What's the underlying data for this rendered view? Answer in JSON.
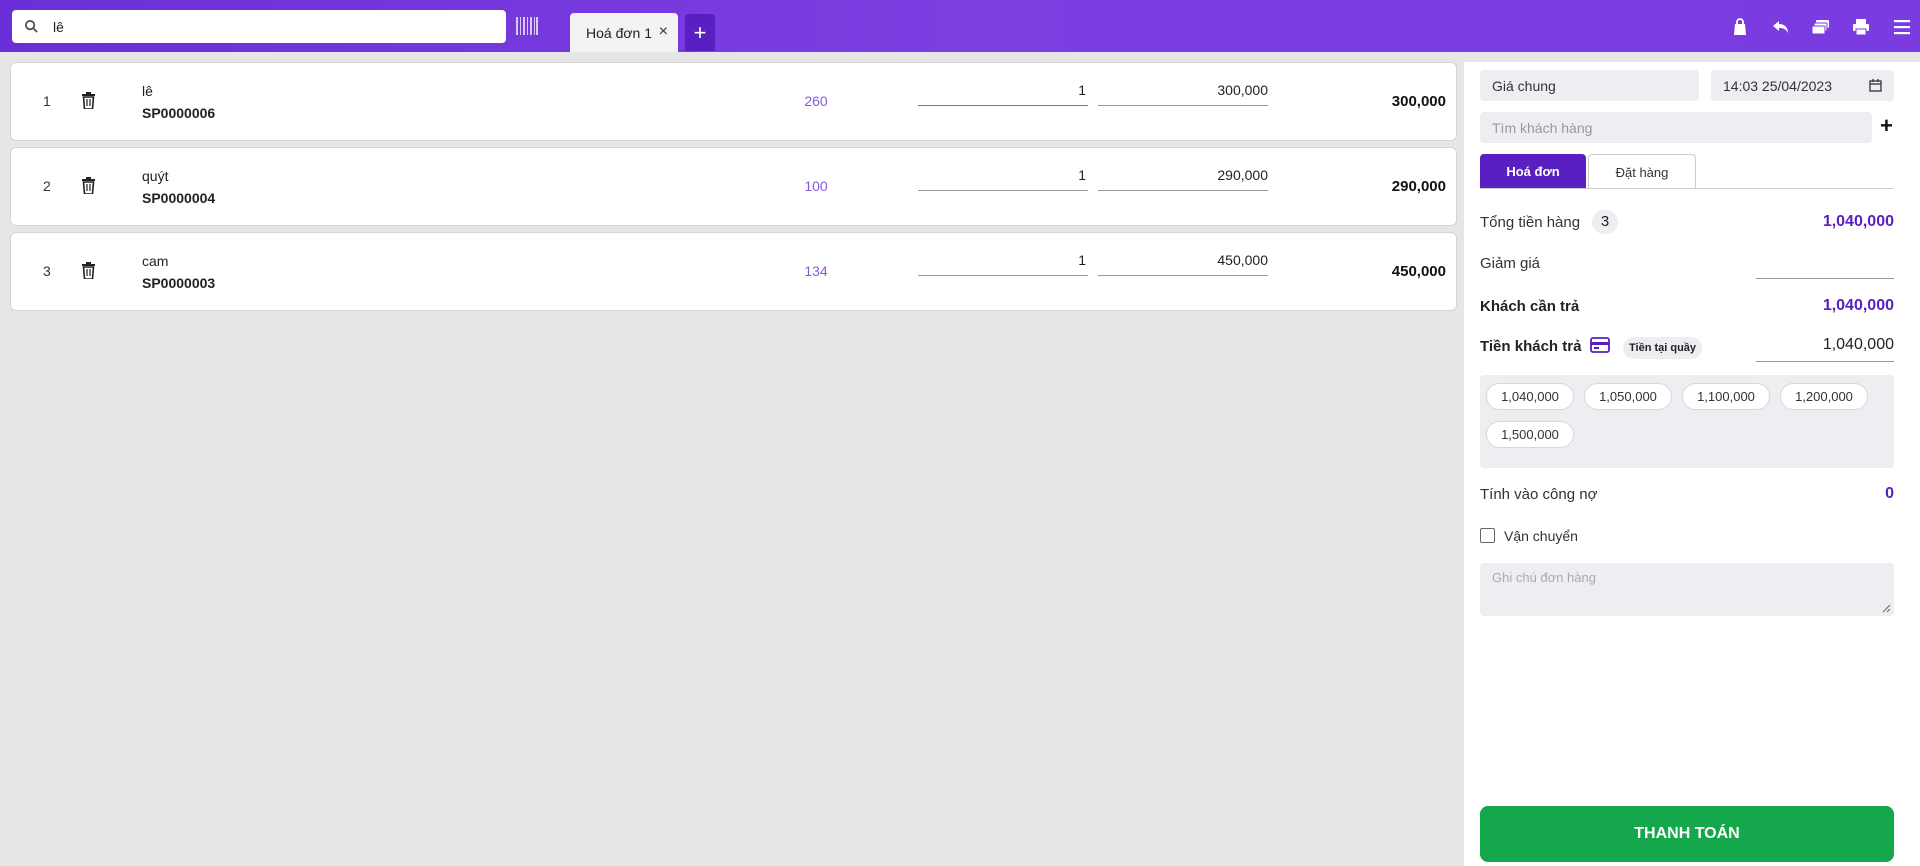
{
  "search": {
    "value": "lê"
  },
  "tabs": [
    {
      "label": "Hoá đơn 1"
    }
  ],
  "add_tab_label": "+",
  "lines": [
    {
      "index": "1",
      "name": "lê",
      "code": "SP0000006",
      "stock": "260",
      "qty": "1",
      "price": "300,000",
      "total": "300,000"
    },
    {
      "index": "2",
      "name": "quýt",
      "code": "SP0000004",
      "stock": "100",
      "qty": "1",
      "price": "290,000",
      "total": "290,000"
    },
    {
      "index": "3",
      "name": "cam",
      "code": "SP0000003",
      "stock": "134",
      "qty": "1",
      "price": "450,000",
      "total": "450,000"
    }
  ],
  "panel": {
    "price_list": "Giá chung",
    "datetime": "14:03 25/04/2023",
    "customer_placeholder": "Tìm khách hàng",
    "doc_tabs": [
      "Hoá đơn",
      "Đặt hàng"
    ],
    "subtotal_label": "Tổng tiền hàng",
    "item_count": "3",
    "subtotal_value": "1,040,000",
    "discount_label": "Giảm giá",
    "due_label": "Khách cần trả",
    "due_value": "1,040,000",
    "paid_label": "Tiền khách trả",
    "paid_method": "Tiền tại quầy",
    "paid_value": "1,040,000",
    "quick_amounts": [
      "1,040,000",
      "1,050,000",
      "1,100,000",
      "1,200,000",
      "1,500,000"
    ],
    "debt_label": "Tính vào công nợ",
    "debt_value": "0",
    "shipping_label": "Vận chuyển",
    "note_placeholder": "Ghi chú đơn hàng",
    "pay_button": "THANH TOÁN"
  },
  "colors": {
    "brand": "#7a3be0",
    "accent": "#5a1fc0",
    "pay": "#15a74b",
    "stock": "#8a5ad8"
  },
  "icons": [
    "search-icon",
    "barcode-icon",
    "close-icon",
    "plus-icon",
    "bag-icon",
    "undo-icon",
    "cash-icon",
    "print-icon",
    "menu-icon",
    "trash-icon",
    "calendar-icon",
    "card-icon",
    "checkbox-icon",
    "resize-icon"
  ]
}
